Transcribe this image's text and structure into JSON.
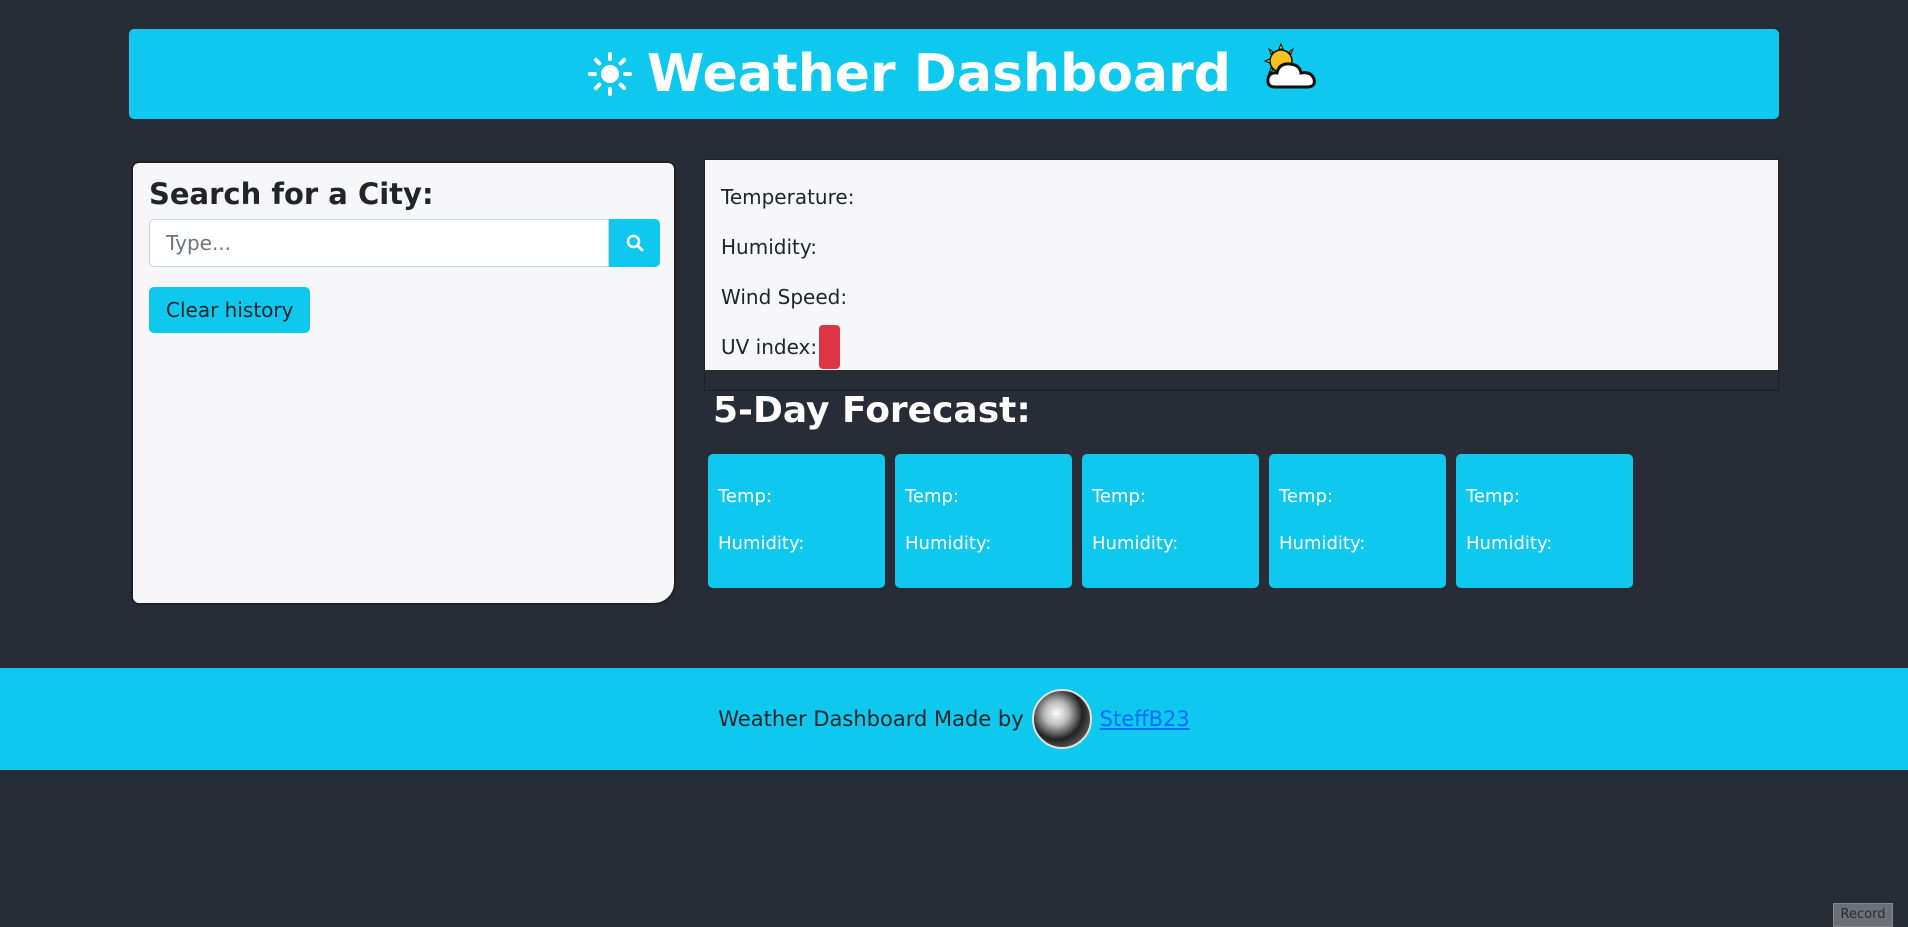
{
  "header": {
    "title": "Weather Dashboard"
  },
  "search": {
    "heading": "Search for a City:",
    "placeholder": "Type...",
    "value": "",
    "clear_label": "Clear history"
  },
  "current": {
    "temperature_label": "Temperature:",
    "humidity_label": "Humidity:",
    "wind_label": "Wind Speed:",
    "uv_label": "UV index:",
    "uv_color": "#dc3545"
  },
  "forecast": {
    "title": "5-Day Forecast:",
    "cards": [
      {
        "temp_label": "Temp:",
        "humidity_label": "Humidity:"
      },
      {
        "temp_label": "Temp:",
        "humidity_label": "Humidity:"
      },
      {
        "temp_label": "Temp:",
        "humidity_label": "Humidity:"
      },
      {
        "temp_label": "Temp:",
        "humidity_label": "Humidity:"
      },
      {
        "temp_label": "Temp:",
        "humidity_label": "Humidity:"
      }
    ]
  },
  "footer": {
    "text": "Weather Dashboard Made by",
    "author_link": "SteffB23"
  },
  "record": {
    "label": "Record"
  },
  "colors": {
    "accent": "#0fc8ee",
    "background": "#282c36",
    "panel": "#f7f7f9"
  }
}
